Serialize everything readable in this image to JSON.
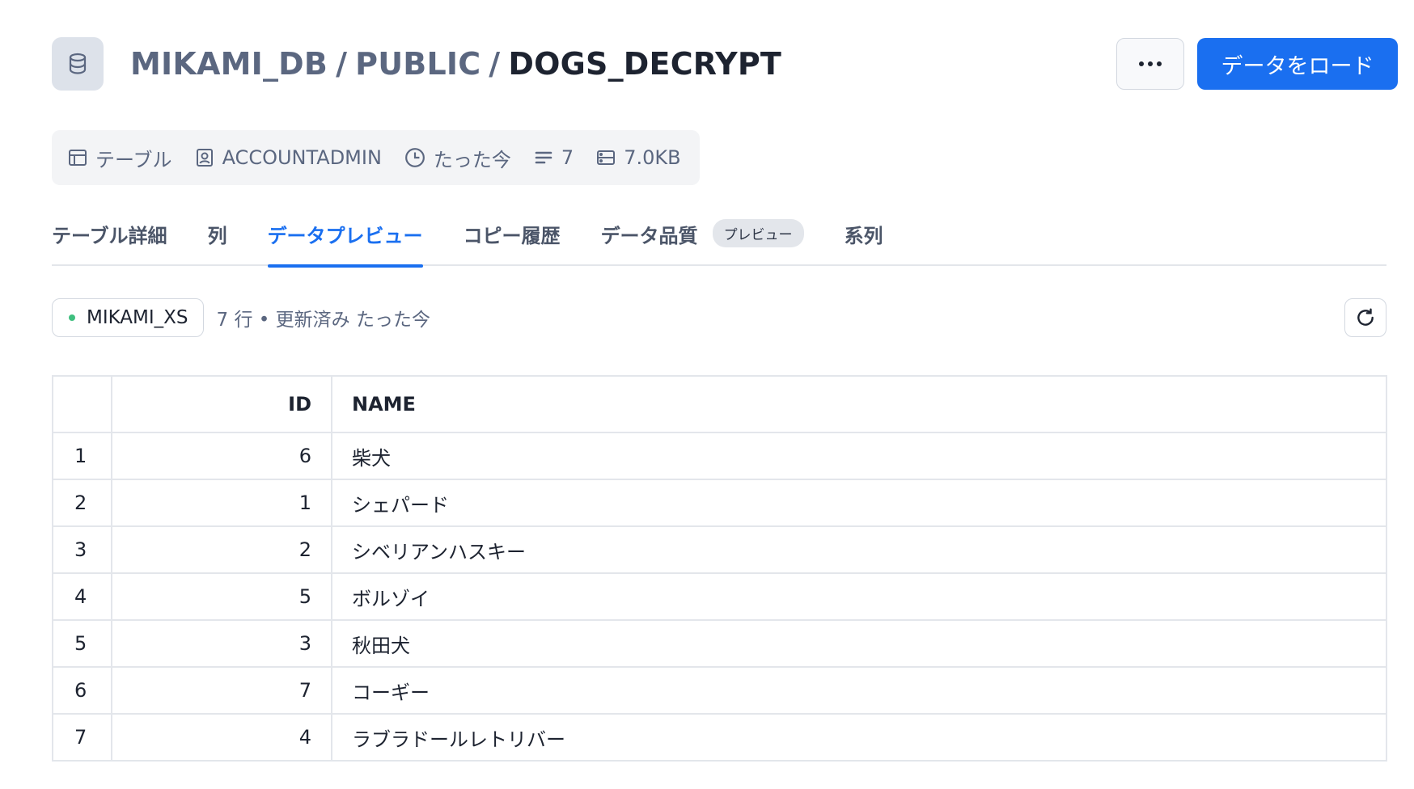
{
  "header": {
    "breadcrumb": [
      "MIKAMI_DB",
      "PUBLIC"
    ],
    "separator": "/",
    "current": "DOGS_DECRYPT",
    "load_button_label": "データをロード",
    "more_button_icon": "ellipsis-icon",
    "accent_color": "#1a6ff0"
  },
  "meta": {
    "type": "テーブル",
    "owner": "ACCOUNTADMIN",
    "updated": "たった今",
    "row_count": "7",
    "size": "7.0KB"
  },
  "tabs": [
    {
      "label": "テーブル詳細",
      "active": false
    },
    {
      "label": "列",
      "active": false
    },
    {
      "label": "データプレビュー",
      "active": true
    },
    {
      "label": "コピー履歴",
      "active": false
    },
    {
      "label": "データ品質",
      "active": false,
      "badge": "プレビュー"
    },
    {
      "label": "系列",
      "active": false
    }
  ],
  "toolbar": {
    "warehouse": "MIKAMI_XS",
    "row_info": "7 行 • 更新済み たった今",
    "status_color": "#3fbf7f"
  },
  "table": {
    "columns": [
      "",
      "ID",
      "NAME"
    ],
    "rows": [
      [
        "1",
        "6",
        "柴犬"
      ],
      [
        "2",
        "1",
        "シェパード"
      ],
      [
        "3",
        "2",
        "シベリアンハスキー"
      ],
      [
        "4",
        "5",
        "ボルゾイ"
      ],
      [
        "5",
        "3",
        "秋田犬"
      ],
      [
        "6",
        "7",
        "コーギー"
      ],
      [
        "7",
        "4",
        "ラブラドールレトリバー"
      ]
    ]
  }
}
